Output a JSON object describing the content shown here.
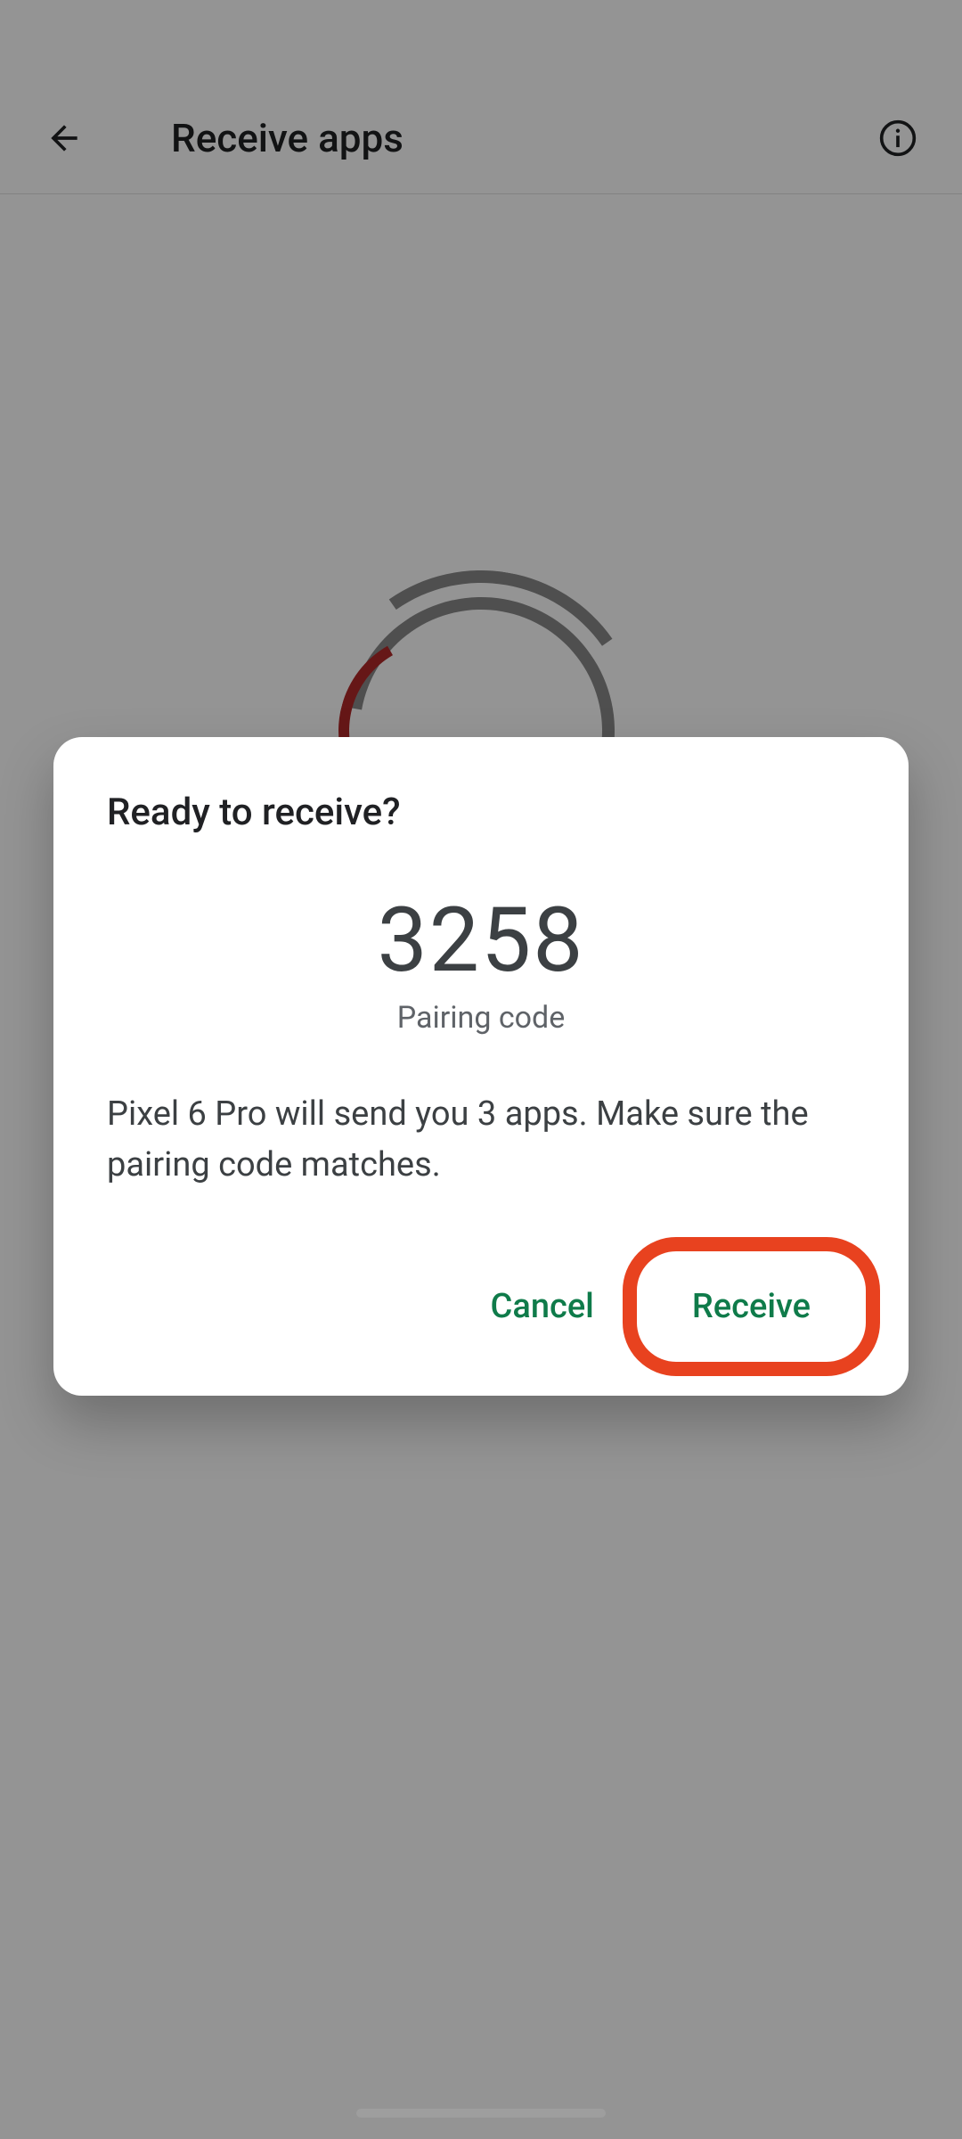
{
  "header": {
    "title": "Receive apps"
  },
  "dialog": {
    "title": "Ready to receive?",
    "pairing_code": "3258",
    "pairing_label": "Pairing code",
    "message": "Pixel 6 Pro will send you 3 apps. Make sure the pairing code matches.",
    "cancel_label": "Cancel",
    "receive_label": "Receive"
  },
  "colors": {
    "accent_green": "#0f7b4a",
    "highlight_ring": "#e8421f",
    "radar_red": "#b02828"
  }
}
